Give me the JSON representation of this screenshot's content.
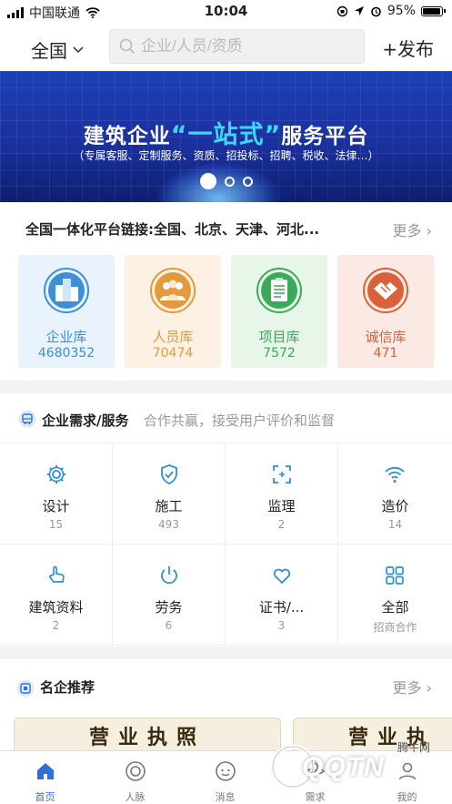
{
  "status_bar": {
    "carrier": "中国联通",
    "time": "10:04",
    "battery": "95%",
    "battery_level": 0.95
  },
  "header": {
    "city": "全国",
    "search_placeholder": "企业/人员/资质",
    "publish": "+发布"
  },
  "banner": {
    "title_pre": "建筑企业",
    "title_highlight": "“一站式”",
    "title_post": "服务平台",
    "subtitle": "（专属客服、定制服务、资质、招投标、招聘、税收、法律…）",
    "active_slide": 0,
    "slide_count": 3
  },
  "platform_links": {
    "text": "全国一体化平台链接:全国、北京、天津、河北...",
    "more": "更多"
  },
  "libraries": [
    {
      "name": "企业库",
      "count": "4680352",
      "color": "#3d8fd6",
      "bg": "#e8f3fd",
      "icon": "buildings-icon"
    },
    {
      "name": "人员库",
      "count": "70474",
      "color": "#e39a3b",
      "bg": "#fdf1e3",
      "icon": "people-icon"
    },
    {
      "name": "项目库",
      "count": "7572",
      "color": "#3aa95a",
      "bg": "#e8f6ea",
      "icon": "clipboard-icon"
    },
    {
      "name": "诚信库",
      "count": "471",
      "color": "#d9623a",
      "bg": "#fbe9e3",
      "icon": "handshake-icon"
    }
  ],
  "services": {
    "title": "企业需求/服务",
    "subtitle": "合作共赢，接受用户评价和监督",
    "items": [
      {
        "name": "设计",
        "count": "15",
        "icon": "gear-icon"
      },
      {
        "name": "施工",
        "count": "493",
        "icon": "shield-check-icon"
      },
      {
        "name": "监理",
        "count": "2",
        "icon": "scan-frame-icon"
      },
      {
        "name": "造价",
        "count": "14",
        "icon": "wifi-icon"
      },
      {
        "name": "建筑资料",
        "count": "2",
        "icon": "hand-pointer-icon"
      },
      {
        "name": "劳务",
        "count": "6",
        "icon": "power-icon"
      },
      {
        "name": "证书/...",
        "count": "3",
        "icon": "heart-icon"
      },
      {
        "name": "全部",
        "count": "招商合作",
        "icon": "grid-icon"
      }
    ]
  },
  "famous": {
    "title": "名企推荐",
    "more": "更多",
    "license_title": "营业执照",
    "license2_title": "营业执"
  },
  "tabs": [
    {
      "label": "首页",
      "icon": "home-icon",
      "active": true
    },
    {
      "label": "人脉",
      "icon": "contacts-icon",
      "active": false
    },
    {
      "label": "消息",
      "icon": "message-icon",
      "active": false
    },
    {
      "label": "需求",
      "icon": "demand-icon",
      "active": false
    },
    {
      "label": "我的",
      "icon": "profile-icon",
      "active": false
    }
  ],
  "watermark": {
    "text": "QQTN",
    "site": "腾牛网"
  },
  "colors": {
    "accent": "#2f6fd8",
    "service_icon": "#2f8fd8"
  }
}
